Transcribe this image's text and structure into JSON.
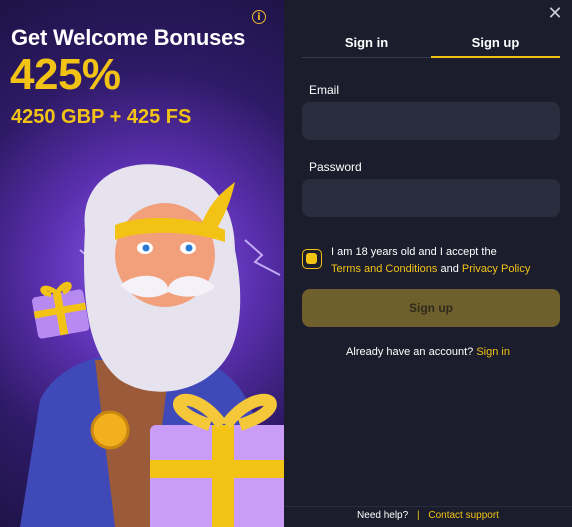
{
  "promo": {
    "headline": "Get Welcome Bonuses",
    "percent": "425%",
    "bonus": "4250 GBP + 425 FS"
  },
  "auth": {
    "tabs": [
      "Sign in",
      "Sign up"
    ],
    "active_tab": "Sign up",
    "email_label": "Email",
    "password_label": "Password",
    "terms_text": "I am 18 years old and I accept the",
    "terms_link": "Terms and Conditions",
    "terms_and": "and",
    "privacy_link": "Privacy Policy",
    "submit_label": "Sign up",
    "already_text": "Already have an account?",
    "signin_link": "Sign in"
  },
  "footer": {
    "help": "Need help?",
    "separator": "|",
    "support": "Contact support"
  },
  "colors": {
    "accent": "#f2c315",
    "panel": "#1b1d2c",
    "field": "#2a2d3d",
    "button": "#6e5f2c"
  },
  "icons": {
    "info": "info-icon",
    "close": "close-icon"
  }
}
